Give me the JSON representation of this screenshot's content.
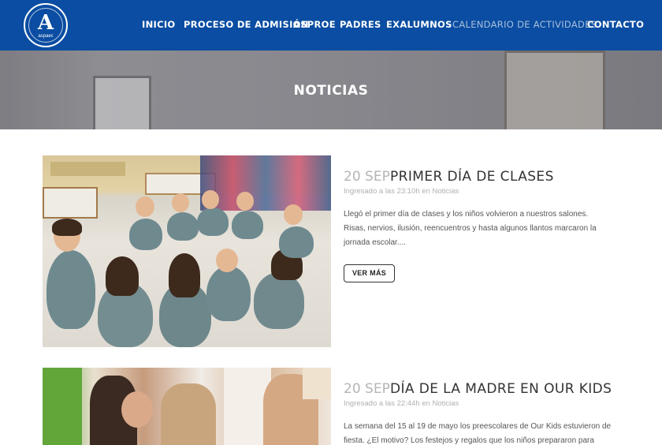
{
  "logo": {
    "letter": "A",
    "subtitle": "aspaec"
  },
  "nav": {
    "items": [
      {
        "label": "INICIO"
      },
      {
        "label": "PROCESO DE ADMISIÓN"
      },
      {
        "label": "ASPROE"
      },
      {
        "label": "PADRES"
      },
      {
        "label": "EXALUMNOS"
      },
      {
        "label": "CALENDARIO DE ACTIVIDADES"
      },
      {
        "label": "CONTACTO"
      }
    ]
  },
  "hero": {
    "title": "NOTICIAS"
  },
  "posts": [
    {
      "date": "20 SEP",
      "title": "PRIMER DÍA DE CLASES",
      "meta": "Ingresado a las 23:10h en Noticias",
      "excerpt": "Llegó el primer día de clases y los niños volvieron a nuestros salones. Risas, nervios, ilusión, reencuentros y hasta algunos llantos marcaron la jornada escolar....",
      "button": "VER MÁS"
    },
    {
      "date": "20 SEP",
      "title": "DÍA DE LA MADRE EN OUR KIDS",
      "meta": "Ingresado a las 22:44h en Noticias",
      "excerpt": "La semana del 15 al 19 de mayo los preescolares de Our Kids estuvieron de fiesta. ¿El motivo? Los festejos y regalos que los niños prepararon para"
    }
  ],
  "colors": {
    "nav_bg": "#0a4da2",
    "nav_active_text": "#a9bfdc",
    "date_gray": "#b5b5b5"
  }
}
